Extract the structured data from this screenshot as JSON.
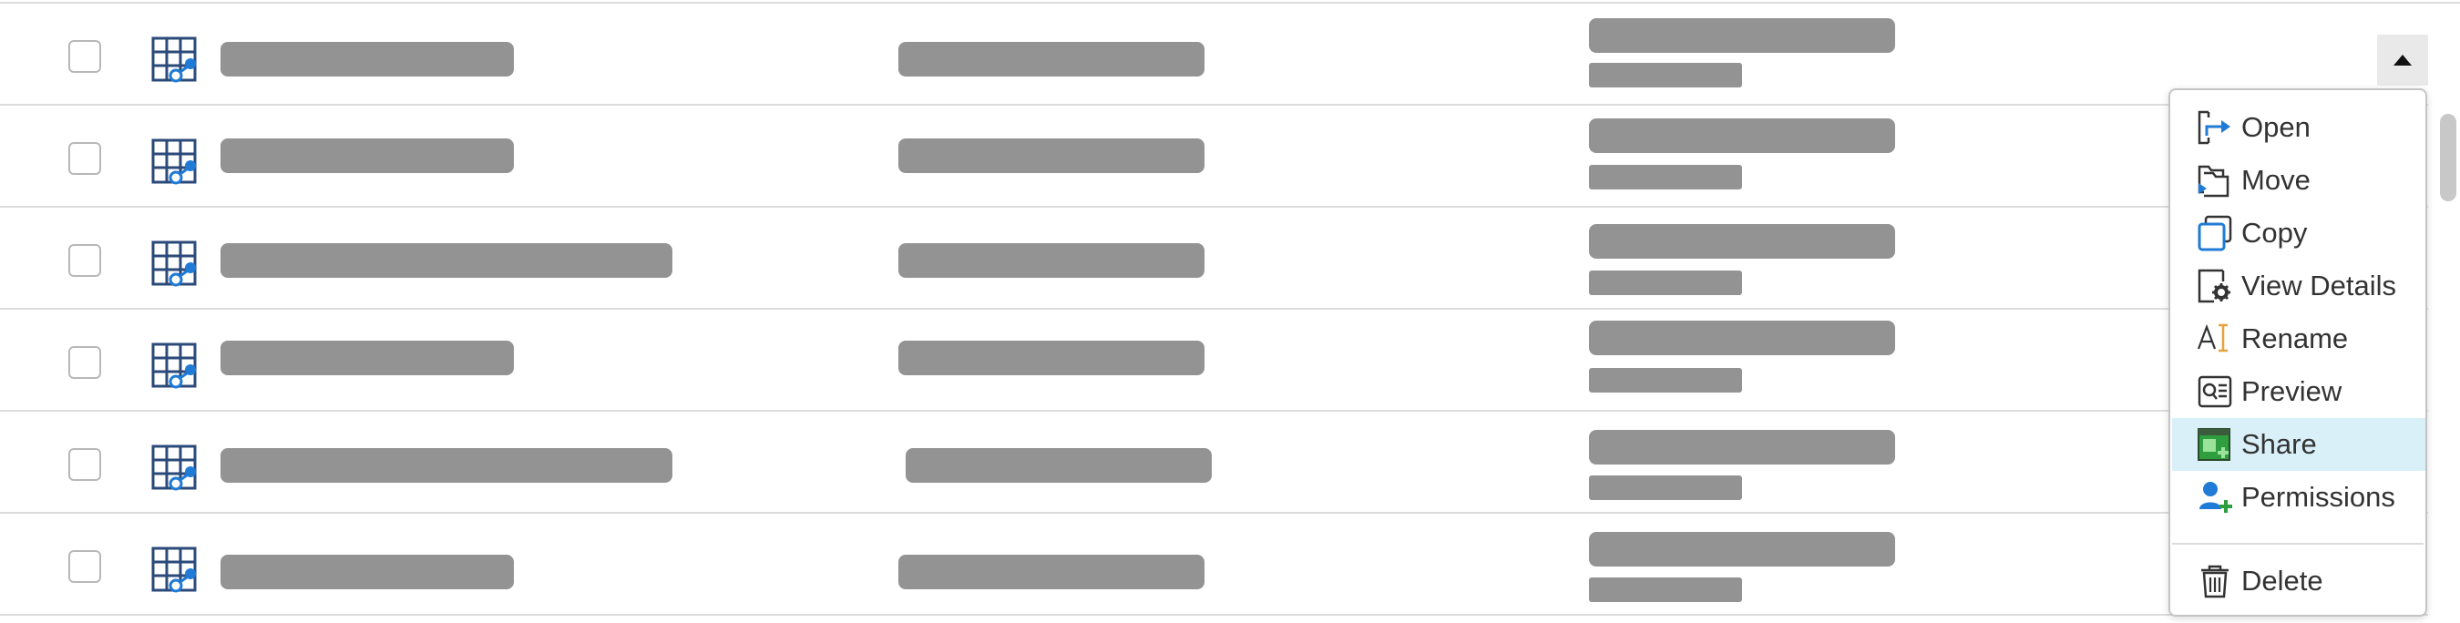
{
  "file_list": {
    "rows": [
      {
        "checked": false,
        "icon": "spreadsheet-icon"
      },
      {
        "checked": false,
        "icon": "spreadsheet-icon"
      },
      {
        "checked": false,
        "icon": "spreadsheet-icon"
      },
      {
        "checked": false,
        "icon": "spreadsheet-icon"
      },
      {
        "checked": false,
        "icon": "spreadsheet-icon"
      },
      {
        "checked": false,
        "icon": "spreadsheet-icon"
      }
    ]
  },
  "context_menu": {
    "items": [
      {
        "label": "Open",
        "icon": "open-icon"
      },
      {
        "label": "Move",
        "icon": "move-icon"
      },
      {
        "label": "Copy",
        "icon": "copy-icon"
      },
      {
        "label": "View Details",
        "icon": "view-details-icon"
      },
      {
        "label": "Rename",
        "icon": "rename-icon"
      },
      {
        "label": "Preview",
        "icon": "preview-icon"
      },
      {
        "label": "Share",
        "icon": "share-icon",
        "highlighted": true
      },
      {
        "label": "Permissions",
        "icon": "permissions-icon"
      },
      {
        "label": "Delete",
        "icon": "delete-icon"
      }
    ]
  },
  "colors": {
    "icon_blue": "#1f7bd6",
    "icon_dark": "#333333",
    "highlight": "#d9f0f9",
    "placeholder_bar": "#939393",
    "share_green": "#2e9e3e"
  }
}
